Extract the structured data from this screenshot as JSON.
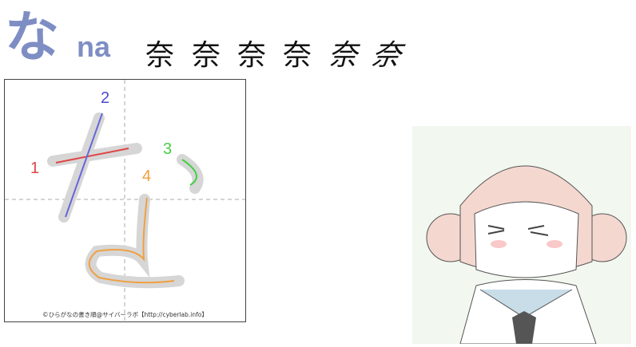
{
  "header": {
    "kana": "な",
    "romaji": "na",
    "origin_kanji": [
      "奈",
      "奈",
      "奈",
      "奈",
      "奈",
      "奈"
    ]
  },
  "stroke_diagram": {
    "stroke_numbers": [
      {
        "n": "1",
        "color": "#e04545"
      },
      {
        "n": "2",
        "color": "#4a4ad0"
      },
      {
        "n": "3",
        "color": "#44d044"
      },
      {
        "n": "4",
        "color": "#f0a040"
      }
    ],
    "caption": "©ひらがなの書き順@サイバーラボ【http://cyberlab.info】"
  },
  "illustration": {
    "subject": "anime-girl"
  }
}
